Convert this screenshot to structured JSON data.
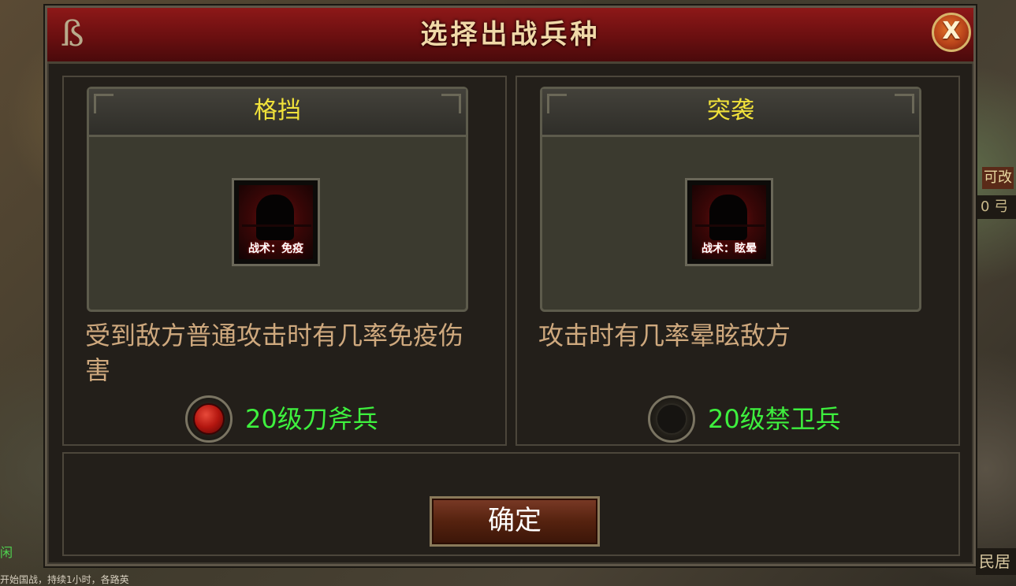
{
  "dialog": {
    "title": "选择出战兵种",
    "close_label": "X",
    "confirm_label": "确定"
  },
  "options": [
    {
      "card_title": "格挡",
      "skill_label": "战术：免疫",
      "description": "受到敌方普通攻击时有几率免疫伤害",
      "unit_label": "20级刀斧兵",
      "selected": true
    },
    {
      "card_title": "突袭",
      "skill_label": "战术：眩晕",
      "description": "攻击时有几率晕眩敌方",
      "unit_label": "20级禁卫兵",
      "selected": false
    }
  ],
  "background": {
    "left_label": "闲",
    "right_a": "可改",
    "right_b": "0 弓",
    "right_c": "民居",
    "ticker": "开始国战，持续1小时，各路英"
  },
  "colors": {
    "title_bar": "#6a0f10",
    "unit_label_green": "#3ef03e",
    "card_title_yellow": "#f1e23a",
    "description_tan": "#cfa97e",
    "radio_selected_red": "#b3160f"
  }
}
